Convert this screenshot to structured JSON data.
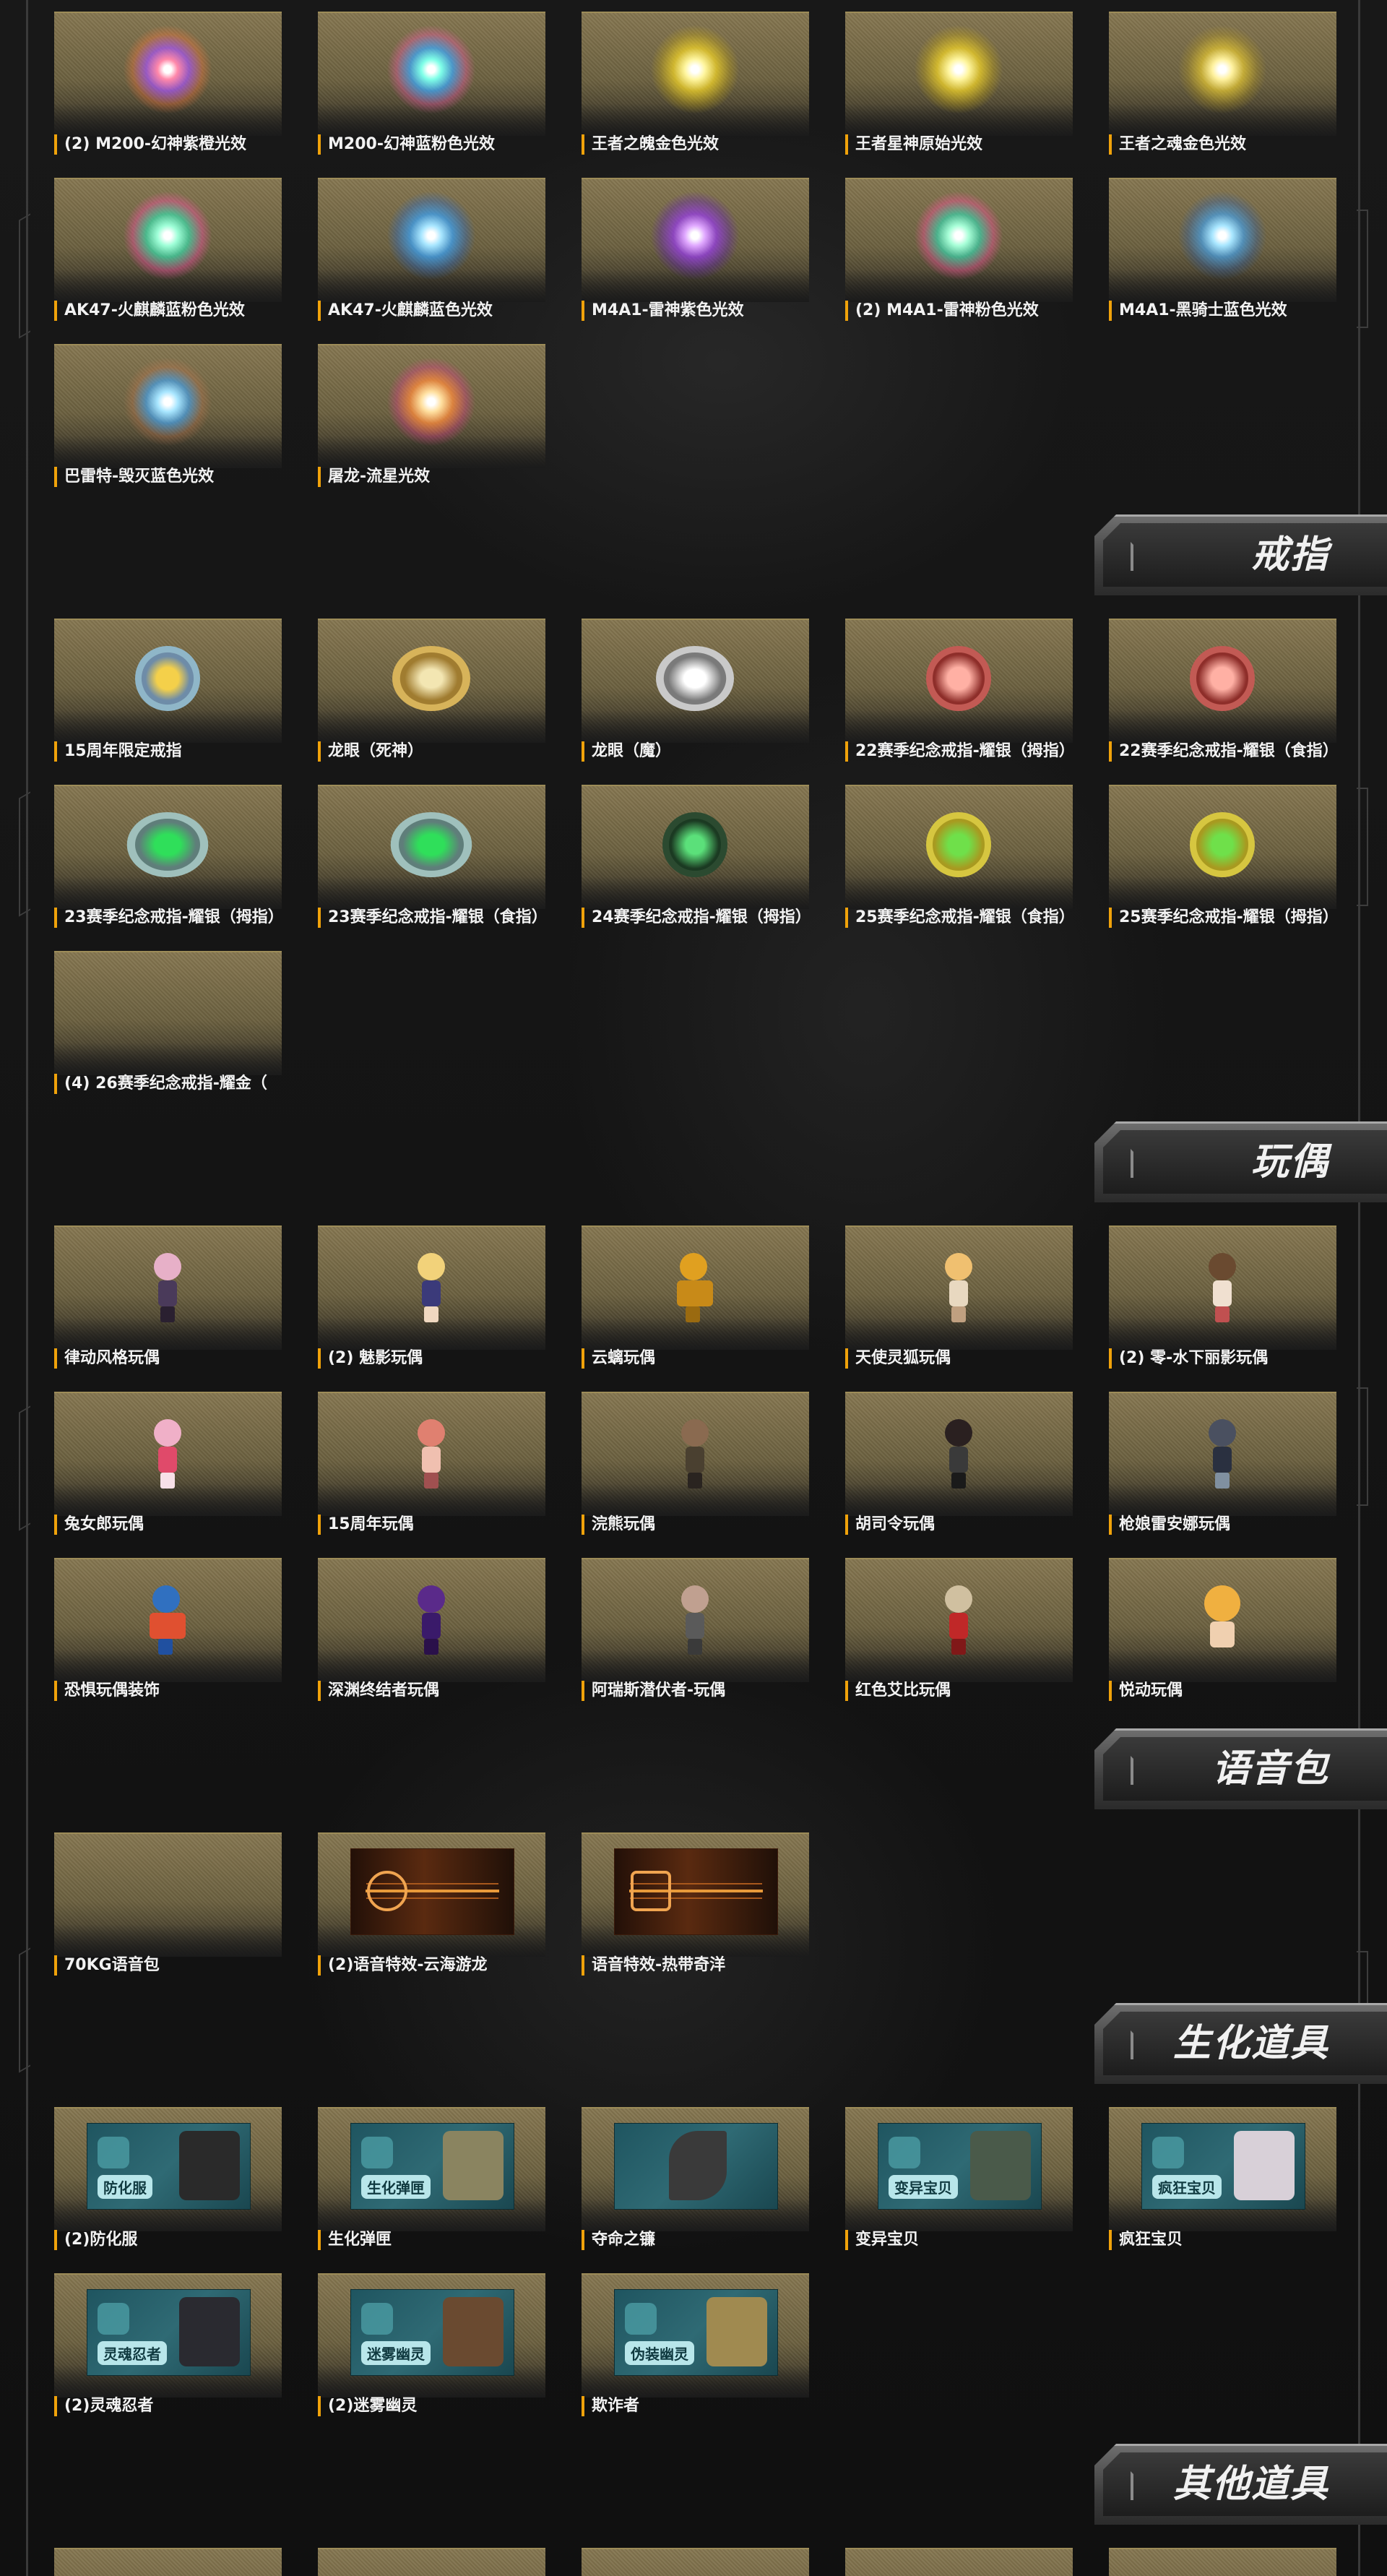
{
  "colors": {
    "accent": "#f0a20a",
    "frame": "#3a3a3a"
  },
  "sections": {
    "effects": {
      "items": [
        "(2) M200-幻神紫橙光效",
        "M200-幻神蓝粉色光效",
        "王者之魄金色光效",
        "王者星神原始光效",
        "王者之魂金色光效",
        "AK47-火麒麟蓝粉色光效",
        "AK47-火麒麟蓝色光效",
        "M4A1-雷神紫色光效",
        "(2) M4A1-雷神粉色光效",
        "M4A1-黑骑士蓝色光效",
        "巴雷特-毁灭蓝色光效",
        "屠龙-流星光效"
      ]
    },
    "rings": {
      "title": "戒指",
      "items": [
        "15周年限定戒指",
        "龙眼（死神）",
        "龙眼（魔）",
        "22赛季纪念戒指-耀银（拇指）",
        "22赛季纪念戒指-耀银（食指）",
        "23赛季纪念戒指-耀银（拇指）",
        "23赛季纪念戒指-耀银（食指）",
        "24赛季纪念戒指-耀银（拇指）",
        "25赛季纪念戒指-耀银（食指）",
        "25赛季纪念戒指-耀银（拇指）",
        "(4) 26赛季纪念戒指-耀金（"
      ]
    },
    "dolls": {
      "title": "玩偶",
      "items": [
        "律动风格玩偶",
        "(2) 魅影玩偶",
        "云螭玩偶",
        "天使灵狐玩偶",
        "(2) 零-水下丽影玩偶",
        "兔女郎玩偶",
        "15周年玩偶",
        "浣熊玩偶",
        "胡司令玩偶",
        "枪娘雷安娜玩偶",
        "恐惧玩偶装饰",
        "深渊终结者玩偶",
        "阿瑞斯潜伏者-玩偶",
        "红色艾比玩偶",
        "悦动玩偶"
      ]
    },
    "voice": {
      "title": "语音包",
      "items": [
        "70KG语音包",
        "(2)语音特效-云海游龙",
        "语音特效-热带奇洋"
      ]
    },
    "bio": {
      "title": "生化道具",
      "items": [
        "(2)防化服",
        "生化弹匣",
        "夺命之镰",
        "变异宝贝",
        "疯狂宝贝",
        "(2)灵魂忍者",
        "(2)迷雾幽灵",
        "欺诈者"
      ],
      "banner_tags": [
        "防化服",
        "生化弹匣",
        "",
        "变异宝贝",
        "疯狂宝贝",
        "灵魂忍者",
        "迷雾幽灵",
        "伪装幽灵"
      ]
    },
    "other": {
      "title": "其他道具"
    }
  }
}
